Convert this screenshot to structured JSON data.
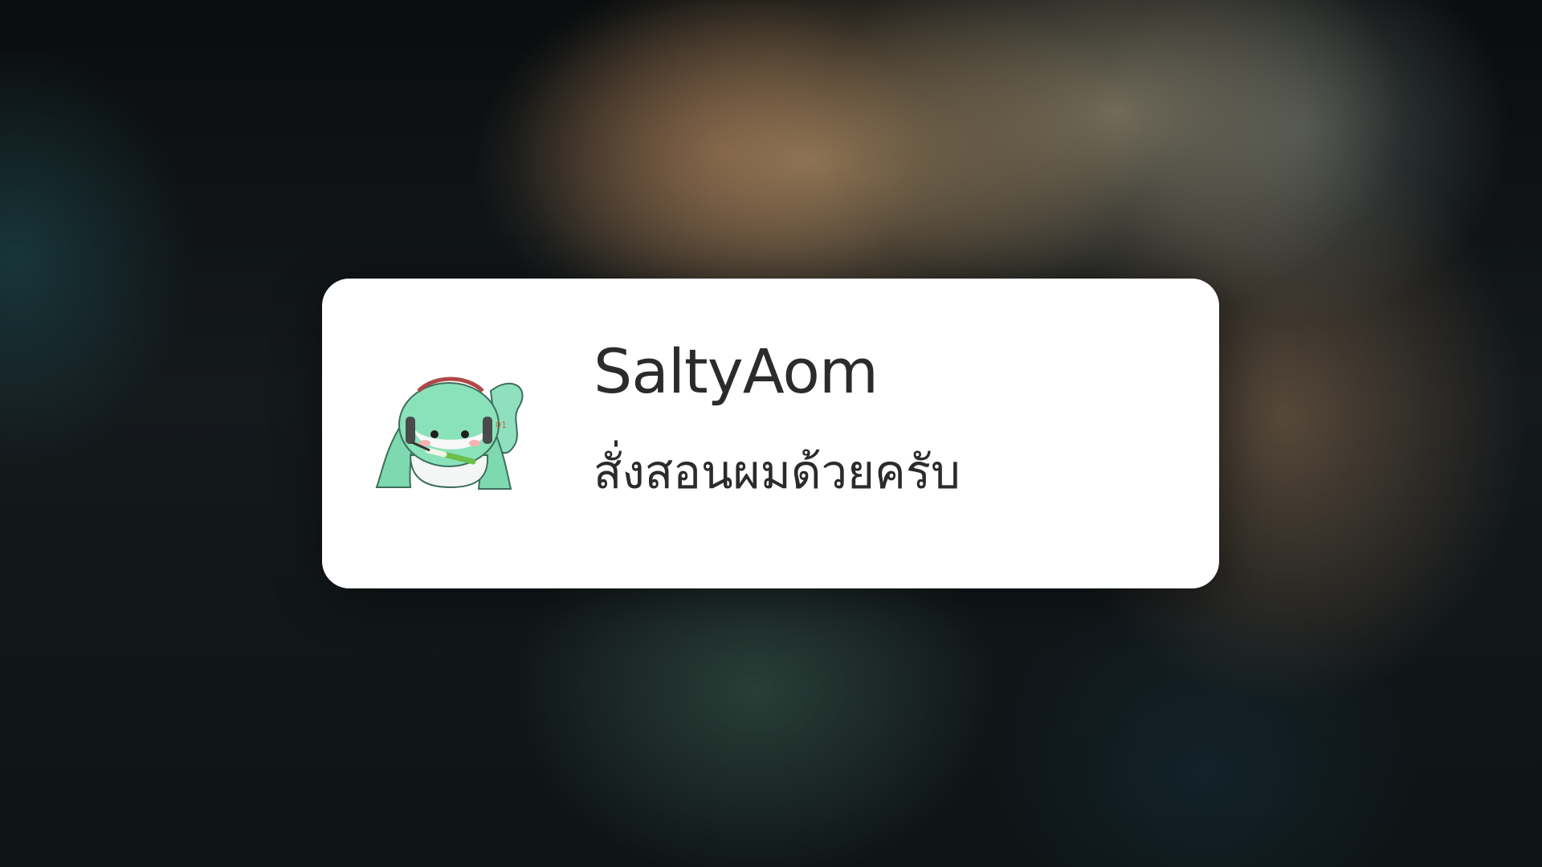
{
  "notification": {
    "title": "SaltyAom",
    "message": "สั่งสอนผมด้วยครับ",
    "avatar_icon": "chibi-miku-sticker-icon"
  },
  "colors": {
    "card_background": "#ffffff",
    "text": "#2b2b2b",
    "avatar_hair": "#7ed9b0"
  }
}
